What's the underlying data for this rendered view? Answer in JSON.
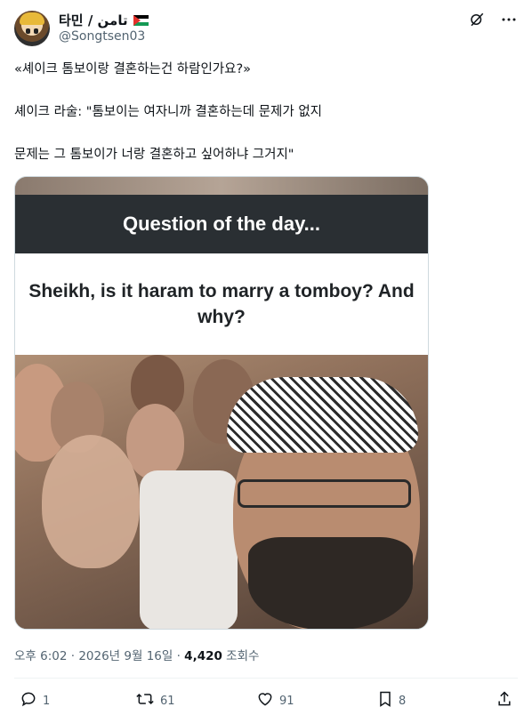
{
  "author": {
    "display_name": "타민 / تامن",
    "flag_icon": "palestine-flag-icon",
    "handle": "@Songtsen03"
  },
  "header_icons": [
    "grok-icon",
    "more-icon"
  ],
  "tweet": {
    "line1": "«셰이크 톰보이랑 결혼하는건 하람인가요?»",
    "line2": "셰이크 라술: \"톰보이는 여자니까 결혼하는데 문제가 없지",
    "line3": "문제는 그 톰보이가 너랑 결혼하고 싶어하냐 그거지\""
  },
  "media": {
    "question_title": "Question of the day...",
    "question_text": "Sheikh, is it haram to marry a tomboy? And why?"
  },
  "meta": {
    "time_date": "오후 6:02 · 2026년 9월 16일 · ",
    "views_count": "4,420",
    "views_label": " 조회수"
  },
  "actions": {
    "reply_count": "1",
    "retweet_count": "61",
    "like_count": "91",
    "bookmark_count": "8"
  },
  "colors": {
    "secondary_text": "#536471",
    "text": "#0f1419",
    "divider": "#eff3f4"
  }
}
